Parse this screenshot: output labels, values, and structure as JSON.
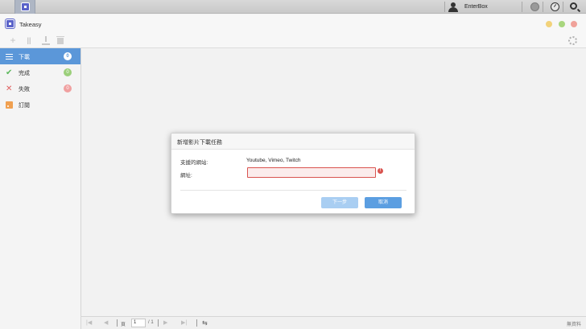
{
  "system_bar": {
    "username": "EnterBox",
    "icons": [
      "app-icon",
      "user-icon",
      "notification-icon",
      "dashboard-icon",
      "search-icon"
    ]
  },
  "window": {
    "title": "Takeasy"
  },
  "toolbar": {
    "icons": [
      "plus-icon",
      "pause-icon",
      "download-icon",
      "trash-icon",
      "gear-icon"
    ]
  },
  "sidebar": {
    "items": [
      {
        "label": "下載",
        "count": "0",
        "icon": "list-icon",
        "active": true
      },
      {
        "label": "完成",
        "count": "0",
        "icon": "check-icon",
        "active": false
      },
      {
        "label": "失敗",
        "count": "0",
        "icon": "x-icon",
        "active": false
      },
      {
        "label": "訂閱",
        "count": "",
        "icon": "rss-icon",
        "active": false
      }
    ]
  },
  "dialog": {
    "title": "新增影片下載任務",
    "sites_label": "支援的網站:",
    "sites_value": "Youtube, Vimeo, Twitch",
    "url_label": "網址:",
    "url_value": "",
    "next_button": "下一步",
    "cancel_button": "取消"
  },
  "pager": {
    "page_label": "頁",
    "page_value": "1",
    "page_total": "/ 1",
    "no_data": "無資料"
  },
  "colors": {
    "accent": "#5b97d9",
    "error": "#d9534f",
    "success": "#5cb85c"
  }
}
